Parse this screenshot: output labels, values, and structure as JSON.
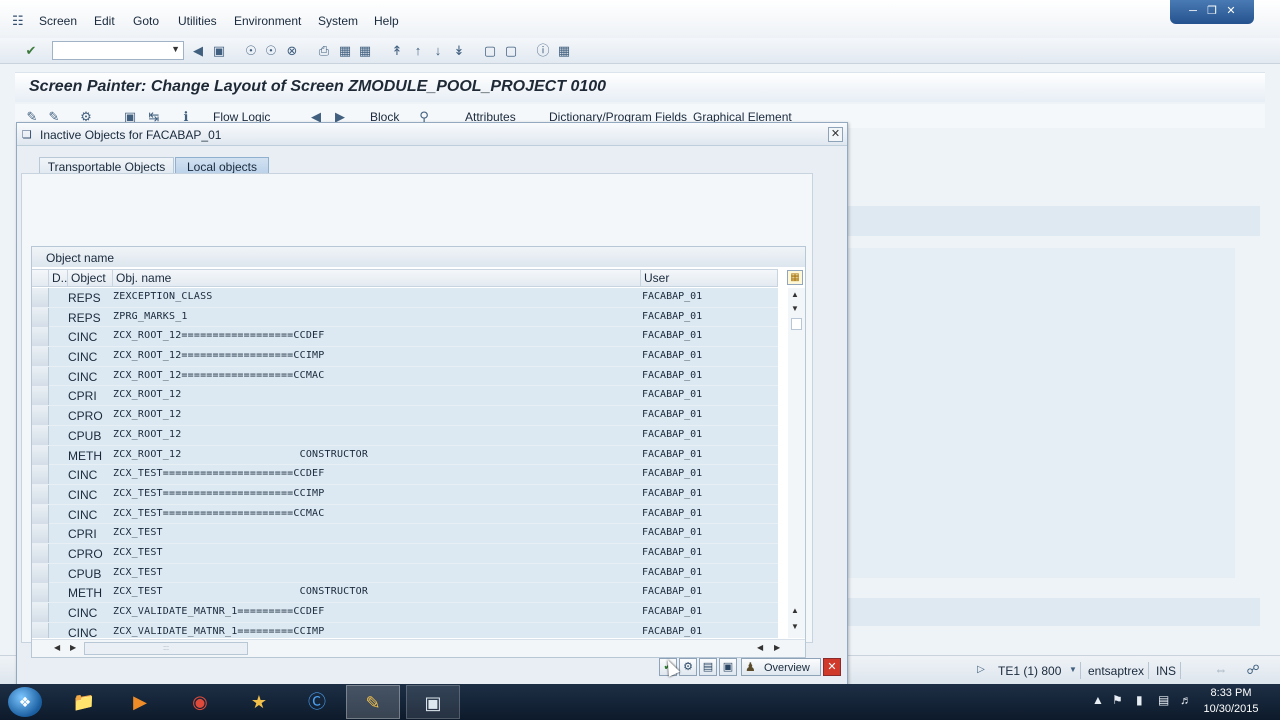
{
  "menu": {
    "items": [
      "Screen",
      "Edit",
      "Goto",
      "Utilities",
      "Environment",
      "System",
      "Help"
    ]
  },
  "window_controls": [
    "minimize",
    "restore",
    "close"
  ],
  "title": "Screen Painter: Change Layout of Screen ZMODULE_POOL_PROJECT 0100",
  "app_toolbar": {
    "flow_logic": "Flow Logic",
    "block": "Block",
    "attributes": "Attributes",
    "dict_fields": "Dictionary/Program Fields",
    "graphical_element": "Graphical Element"
  },
  "dialog": {
    "title": "Inactive Objects for FACABAP_01",
    "tabs": [
      "Transportable Objects",
      "Local objects"
    ],
    "active_tab": "Local objects",
    "grid_title": "Object name",
    "columns": [
      "D..",
      "Object",
      "Obj. name",
      "User"
    ],
    "rows": [
      {
        "object": "REPS",
        "name": "ZEXCEPTION_CLASS",
        "user": "FACABAP_01"
      },
      {
        "object": "REPS",
        "name": "ZPRG_MARKS_1",
        "user": "FACABAP_01"
      },
      {
        "object": "CINC",
        "name": "ZCX_ROOT_12==================CCDEF",
        "user": "FACABAP_01"
      },
      {
        "object": "CINC",
        "name": "ZCX_ROOT_12==================CCIMP",
        "user": "FACABAP_01"
      },
      {
        "object": "CINC",
        "name": "ZCX_ROOT_12==================CCMAC",
        "user": "FACABAP_01"
      },
      {
        "object": "CPRI",
        "name": "ZCX_ROOT_12",
        "user": "FACABAP_01"
      },
      {
        "object": "CPRO",
        "name": "ZCX_ROOT_12",
        "user": "FACABAP_01"
      },
      {
        "object": "CPUB",
        "name": "ZCX_ROOT_12",
        "user": "FACABAP_01"
      },
      {
        "object": "METH",
        "name": "ZCX_ROOT_12                   CONSTRUCTOR",
        "user": "FACABAP_01"
      },
      {
        "object": "CINC",
        "name": "ZCX_TEST=====================CCDEF",
        "user": "FACABAP_01"
      },
      {
        "object": "CINC",
        "name": "ZCX_TEST=====================CCIMP",
        "user": "FACABAP_01"
      },
      {
        "object": "CINC",
        "name": "ZCX_TEST=====================CCMAC",
        "user": "FACABAP_01"
      },
      {
        "object": "CPRI",
        "name": "ZCX_TEST",
        "user": "FACABAP_01"
      },
      {
        "object": "CPRO",
        "name": "ZCX_TEST",
        "user": "FACABAP_01"
      },
      {
        "object": "CPUB",
        "name": "ZCX_TEST",
        "user": "FACABAP_01"
      },
      {
        "object": "METH",
        "name": "ZCX_TEST                      CONSTRUCTOR",
        "user": "FACABAP_01"
      },
      {
        "object": "CINC",
        "name": "ZCX_VALIDATE_MATNR_1=========CCDEF",
        "user": "FACABAP_01"
      },
      {
        "object": "CINC",
        "name": "ZCX_VALIDATE_MATNR_1=========CCIMP",
        "user": "FACABAP_01"
      }
    ],
    "buttons": {
      "overview": "Overview"
    }
  },
  "status": {
    "system": "TE1 (1) 800",
    "server": "entsaptrex",
    "mode": "INS"
  },
  "taskbar": {
    "time": "8:33 PM",
    "date": "10/30/2015"
  }
}
